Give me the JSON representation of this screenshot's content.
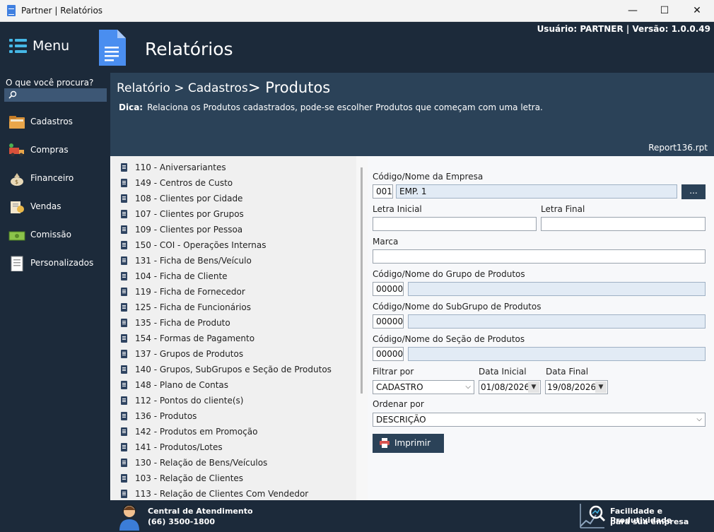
{
  "window": {
    "title": "Partner | Relatórios",
    "minimize": "—",
    "maximize": "☐",
    "close": "✕"
  },
  "sidebar": {
    "menu_label": "Menu",
    "search_label": "O que você procura?",
    "search_value": "",
    "items": [
      {
        "label": "Cadastros",
        "icon": "folder-icon"
      },
      {
        "label": "Compras",
        "icon": "truck-icon"
      },
      {
        "label": "Financeiro",
        "icon": "money-bag-icon"
      },
      {
        "label": "Vendas",
        "icon": "sales-icon"
      },
      {
        "label": "Comissão",
        "icon": "cash-icon"
      },
      {
        "label": "Personalizados",
        "icon": "document-icon"
      }
    ]
  },
  "header": {
    "title": "Relatórios",
    "user_info": "Usuário: PARTNER | Versão: 1.0.0.49"
  },
  "breadcrumb": {
    "path": "Relatório > Cadastros",
    "current": "> Produtos"
  },
  "tip": {
    "label": "Dica:",
    "text": "Relaciona os Produtos cadastrados, pode-se escolher Produtos que começam com uma letra."
  },
  "report_file": "Report136.rpt",
  "report_list": [
    "110 - Aniversariantes",
    "149 - Centros de Custo",
    "108 - Clientes por Cidade",
    "107 - Clientes por Grupos",
    "109 - Clientes por Pessoa",
    "150 - COI - Operações Internas",
    "131 - Ficha de Bens/Veículo",
    "104 - Ficha de Cliente",
    "119 - Ficha de Fornecedor",
    "125 - Ficha de Funcionários",
    "135 - Ficha de Produto",
    "154 - Formas de Pagamento",
    "137 - Grupos de Produtos",
    "140 - Grupos, SubGrupos e Seção de Produtos",
    "148 - Plano de Contas",
    "112 - Pontos do cliente(s)",
    "136 - Produtos",
    "142 - Produtos em Promoção",
    "141 - Produtos/Lotes",
    "130 - Relação de Bens/Veículos",
    "103 - Relação de Clientes",
    "113 - Relação de Clientes Com Vendedor"
  ],
  "form": {
    "empresa_label": "Código/Nome da Empresa",
    "empresa_code": "001",
    "empresa_name": "EMP. 1",
    "dots_label": "...",
    "letra_inicial_label": "Letra Inicial",
    "letra_inicial_value": "",
    "letra_final_label": "Letra Final",
    "letra_final_value": "",
    "marca_label": "Marca",
    "marca_value": "",
    "grupo_label": "Código/Nome do Grupo de Produtos",
    "grupo_code": "00000",
    "grupo_name": "",
    "subgrupo_label": "Código/Nome do SubGrupo de Produtos",
    "subgrupo_code": "00000",
    "subgrupo_name": "",
    "secao_label": "Código/Nome do Seção de Produtos",
    "secao_code": "00000",
    "secao_name": "",
    "filtrar_label": "Filtrar por",
    "filtrar_value": "CADASTRO",
    "data_inicial_label": "Data Inicial",
    "data_inicial_value": "01/08/2026",
    "data_final_label": "Data Final",
    "data_final_value": "19/08/2026",
    "ordenar_label": "Ordenar por",
    "ordenar_value": "DESCRIÇÃO",
    "print_label": "Imprimir"
  },
  "footer": {
    "support_title": "Central de Atendimento",
    "support_phone": "(66) 3500-1800",
    "slogan_line1": "Facilidade e Produtividade",
    "slogan_line2": "para sua empresa"
  },
  "colors": {
    "dark_navy": "#1c2a3a",
    "steel_blue": "#2b4258",
    "accent": "#46b8e6"
  }
}
